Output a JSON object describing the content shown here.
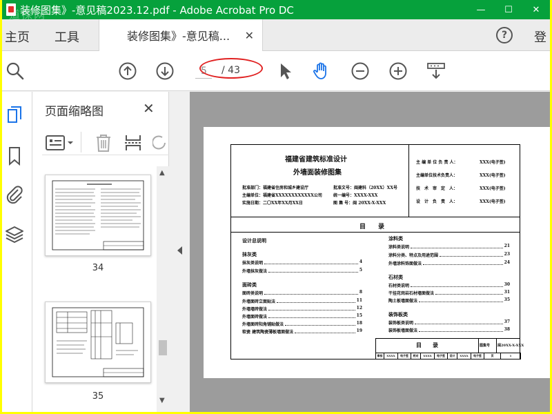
{
  "titlebar": {
    "title": "装修图集》-意见稿2023.12.pdf - Adobe Acrobat Pro DC",
    "watermark": "道探网",
    "minimize": "—",
    "maximize": "☐",
    "close": "✕"
  },
  "tabs": {
    "home": "主页",
    "tools": "工具",
    "document": "装修图集》-意见稿...",
    "close": "✕",
    "help": "?",
    "login": "登"
  },
  "toolbar": {
    "current_page": "5",
    "page_total": "/ 43"
  },
  "panel": {
    "title": "页面缩略图",
    "close": "✕",
    "thumbnails": [
      {
        "label": "34"
      },
      {
        "label": "35"
      }
    ]
  },
  "document": {
    "header_title_1": "福建省建筑标准设计",
    "header_title_2": "外墙面装修图集",
    "meta": [
      {
        "left": "批准部门：福建省住房和城乡建设厅",
        "right": "批准文号：闽建科（20XX）XX号"
      },
      {
        "left": "主编单位：福建省XXXXXXXXXXXX公司",
        "right": "统一编号：XXXX-XXX"
      },
      {
        "left": "实施日期：二〇XX年XX月XX日",
        "right": "图 集 号：闽 20XX-X-XXX"
      }
    ],
    "signers": [
      {
        "role": "主 编 单 位 负 责 人：",
        "name": "XXX(电子签)"
      },
      {
        "role": "主编单位技术负责人：",
        "name": "XXX(电子签)"
      },
      {
        "role": "技　术　审　定　人：",
        "name": "XXX(电子签)"
      },
      {
        "role": "设　计　负　责　人：",
        "name": "XXX(电子签)"
      }
    ],
    "toc_title": "目　　录",
    "toc_left": [
      {
        "text": "设计总说明",
        "page": "",
        "heading": true
      },
      {
        "text": "抹灰类",
        "page": "",
        "heading": true
      },
      {
        "text": "抹灰类说明",
        "page": "4"
      },
      {
        "text": "外墙抹灰做法",
        "page": "5"
      },
      {
        "text": "面砖类",
        "page": "",
        "heading": true
      },
      {
        "text": "面砖类说明",
        "page": "8"
      },
      {
        "text": "外墙面砖立面贴法",
        "page": "11"
      },
      {
        "text": "外墙墙砖做法",
        "page": "12"
      },
      {
        "text": "外墙面砖做法",
        "page": "15"
      },
      {
        "text": "外墙面砖阳角铺贴做法",
        "page": "18"
      },
      {
        "text": "软瓷 建筑陶瓷薄板墙面做法",
        "page": "19"
      }
    ],
    "toc_right": [
      {
        "text": "涂料类",
        "page": "",
        "heading": true
      },
      {
        "text": "涂料类说明",
        "page": "21"
      },
      {
        "text": "涂料分类、特点及用途范围",
        "page": "23"
      },
      {
        "text": "外墙涂料饰面做法",
        "page": "24"
      },
      {
        "text": "石材类",
        "page": "",
        "heading": true
      },
      {
        "text": "石材类说明",
        "page": "30"
      },
      {
        "text": "干挂花岗岩石材墙面做法",
        "page": "31"
      },
      {
        "text": "陶土板墙面做法",
        "page": "35"
      },
      {
        "text": "装饰板类",
        "page": "",
        "heading": true
      },
      {
        "text": "装饰板类说明",
        "page": "37"
      },
      {
        "text": "装饰板墙面做法",
        "page": "38"
      }
    ],
    "titleblock": {
      "name": "目　　录",
      "set_label": "图集号",
      "set_no": "闽20XX-X-XXX",
      "row": [
        "审核",
        "XXXX",
        "电子签",
        "校对",
        "XXXX",
        "电子签",
        "设计",
        "XXXX",
        "电子签",
        "页",
        "1"
      ]
    }
  }
}
